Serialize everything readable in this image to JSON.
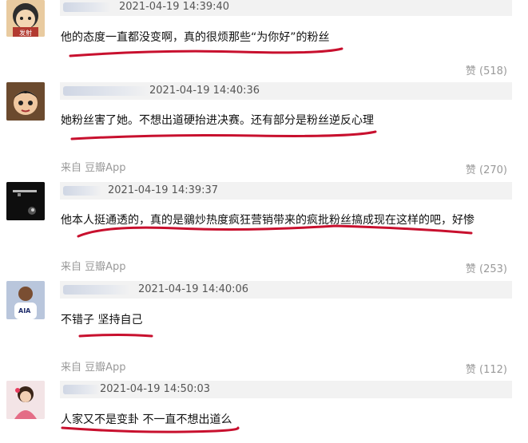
{
  "comments": [
    {
      "time": "2021-04-19 14:39:40",
      "content": "他的态度一直都没变啊，真的很烦那些“为你好”的粉丝",
      "source": "",
      "likes": "赞 (518)",
      "avatar_caption": "发射"
    },
    {
      "time": "2021-04-19 14:40:36",
      "content": "她粉丝害了她。不想出道硬抬进决赛。还有部分是粉丝逆反心理",
      "source": "来自 豆瓣App",
      "likes": "赞 (270)"
    },
    {
      "time": "2021-04-19 14:39:37",
      "content": "他本人挺通透的，真的是鶸炒热度疯狂营销带来的疯批粉丝搞成现在这样的吧，好惨",
      "source": "来自 豆瓣App",
      "likes": "赞 (253)"
    },
    {
      "time": "2021-04-19 14:40:06",
      "content": "不错子 坚持自己",
      "source": "来自 豆瓣App",
      "likes": "赞 (112)",
      "avatar_caption": "AIA"
    },
    {
      "time": "2021-04-19 14:50:03",
      "content": "人家又不是变卦 不一直不想出道么",
      "source": "",
      "likes": ""
    }
  ],
  "colors": {
    "underline": "#c8102e",
    "meta_bg": "#f2f2f2",
    "muted_text": "#999999"
  }
}
